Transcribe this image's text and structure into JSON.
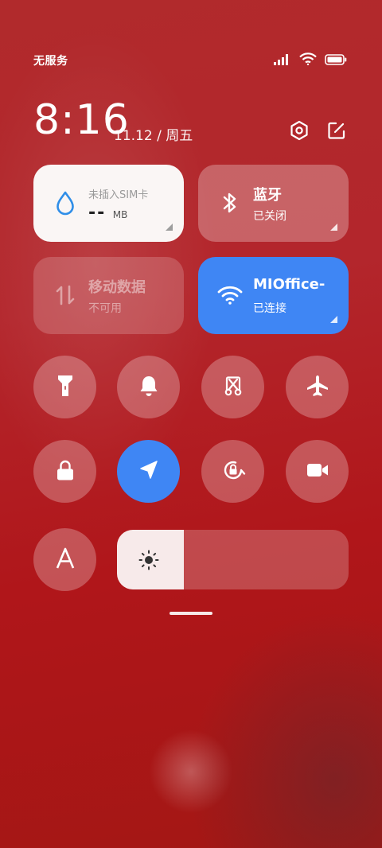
{
  "status_bar": {
    "carrier": "无服务",
    "icons": [
      "signal-icon",
      "wifi-icon",
      "battery-icon"
    ]
  },
  "header": {
    "time": "8:16",
    "date": "11.12 / 周五",
    "icons": [
      "settings-icon",
      "edit-icon"
    ]
  },
  "tiles": {
    "sim": {
      "title": "未插入SIM卡",
      "value": "--",
      "unit": "MB",
      "icon": "water-drop-icon"
    },
    "bluetooth": {
      "title": "蓝牙",
      "status": "已关闭",
      "icon": "bluetooth-icon"
    },
    "mobile_data": {
      "title": "移动数据",
      "status": "不可用",
      "icon": "data-arrows-icon"
    },
    "wifi": {
      "title": "MIOffice-",
      "status": "已连接",
      "icon": "wifi-icon"
    }
  },
  "toggles": [
    {
      "name": "flashlight",
      "icon": "flashlight-icon",
      "active": false
    },
    {
      "name": "ring",
      "icon": "bell-icon",
      "active": false
    },
    {
      "name": "screenshot",
      "icon": "scissors-icon",
      "active": false
    },
    {
      "name": "airplane",
      "icon": "airplane-icon",
      "active": false
    },
    {
      "name": "lock",
      "icon": "lock-icon",
      "active": false
    },
    {
      "name": "location",
      "icon": "location-arrow-icon",
      "active": true
    },
    {
      "name": "rotation-lock",
      "icon": "rotation-lock-icon",
      "active": false
    },
    {
      "name": "screen-record",
      "icon": "video-camera-icon",
      "active": false
    },
    {
      "name": "auto-brightness",
      "icon": "font-a-icon",
      "active": false
    }
  ],
  "brightness": {
    "level": 0.29,
    "icon": "sun-icon"
  },
  "colors": {
    "accent": "#3f86f4",
    "sim_tile": "#faf6f5",
    "sim_icon": "#2f8ee8",
    "background": "#b0161a"
  }
}
